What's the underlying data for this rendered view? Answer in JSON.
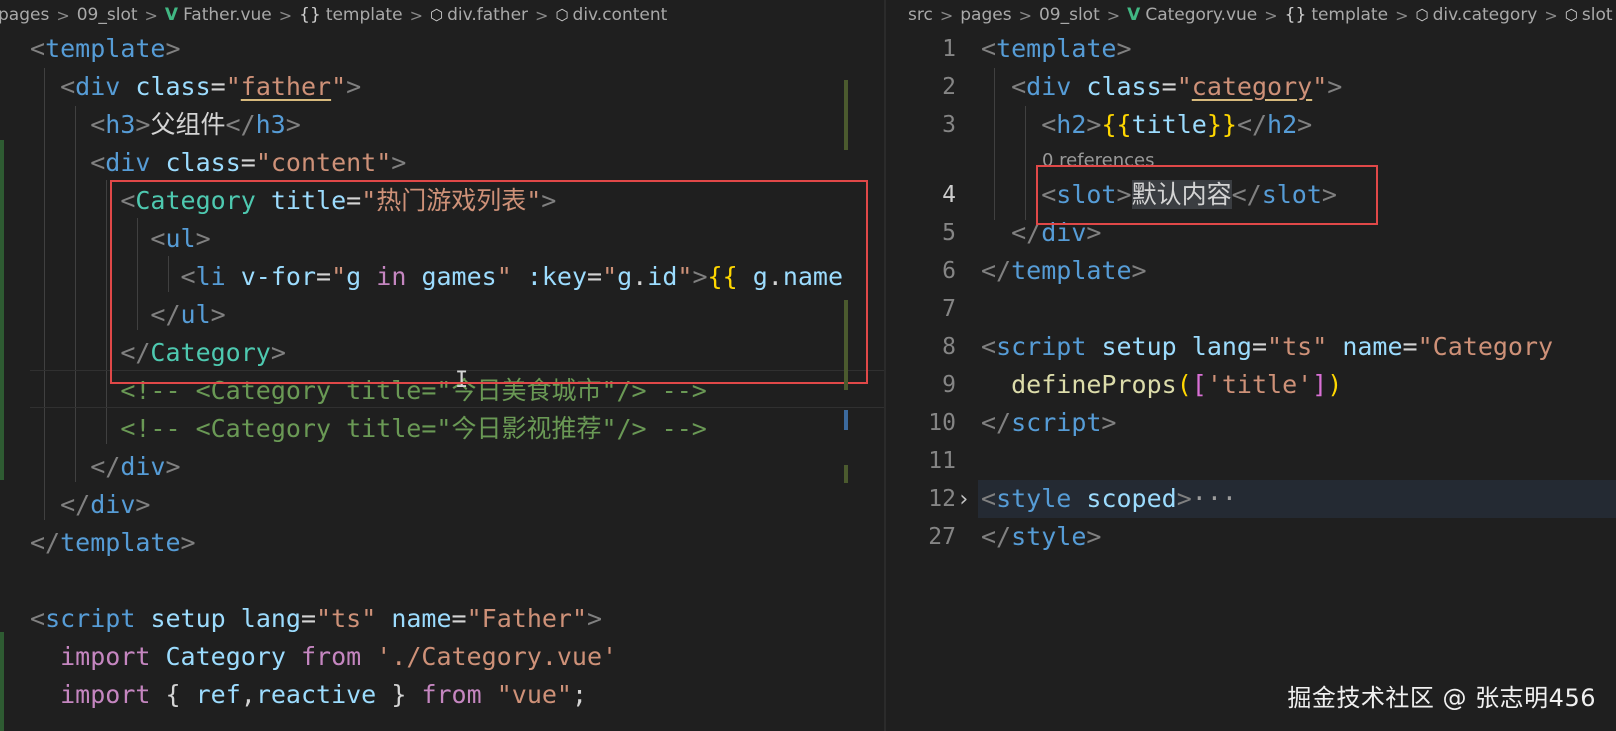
{
  "left_editor": {
    "breadcrumb": [
      {
        "icon": "",
        "label": "pages"
      },
      {
        "icon": "",
        "label": "09_slot"
      },
      {
        "icon": "vue-logo-icon",
        "label": "Father.vue"
      },
      {
        "icon": "braces-icon",
        "label": "template"
      },
      {
        "icon": "cube-icon",
        "label": "div.father"
      },
      {
        "icon": "cube-icon",
        "label": "div.content"
      }
    ]
  },
  "right_editor": {
    "breadcrumb": [
      {
        "icon": "",
        "label": "src"
      },
      {
        "icon": "",
        "label": "pages"
      },
      {
        "icon": "",
        "label": "09_slot"
      },
      {
        "icon": "vue-logo-icon",
        "label": "Category.vue"
      },
      {
        "icon": "braces-icon",
        "label": "template"
      },
      {
        "icon": "cube-icon",
        "label": "div.category"
      },
      {
        "icon": "cube-icon",
        "label": "slot"
      }
    ],
    "line_numbers": [
      "1",
      "2",
      "3",
      "4",
      "5",
      "6",
      "7",
      "8",
      "9",
      "10",
      "11",
      "12",
      "27"
    ],
    "codelens": "0 references",
    "folded_ellipsis": "···"
  },
  "watermark": "掘金技术社区 @ 张志明456",
  "colors": {
    "highlight_box": "#e04848",
    "vue_logo": "#41b883"
  }
}
